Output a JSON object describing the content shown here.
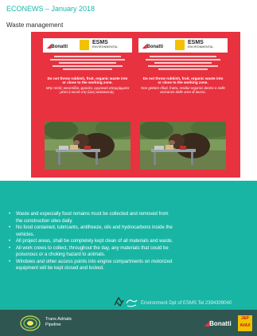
{
  "header": {
    "title": "ECONEWS – January 2018",
    "subtitle": "Waste management"
  },
  "poster": {
    "panels": [
      {
        "brand_left": "Bonatti",
        "brand_mid": "J&P AVAX",
        "brand_right": "ESMS",
        "brand_right_sub": "ENVIRONMENTAL",
        "warning_en": "Do not throw rubbish, fruit, organic waste into or close to the working zone.",
        "warning_local": "Μην πετάς σκουπίδια, φρούτα, οργανικά απορρίμματα μέσα ή κοντά στη ζώνη κατασκευής."
      },
      {
        "brand_left": "Bonatti",
        "brand_mid": "J&P AVAX",
        "brand_right": "ESMS",
        "brand_right_sub": "ENVIRONMENTAL",
        "warning_en": "Do not throw rubbish, fruit, organic waste into or close to the working zone.",
        "warning_local": "Non gettare rifiuti, frutta, residui organici dentro o nelle vicinanze delle aree di lavoro."
      }
    ]
  },
  "bullets": [
    "Waste and especially food remains must be collected and removed from",
    "the construction sites daily.",
    "No food contained, lubricants, antifreeze, oils and hydrocarbons inside the",
    "vehicles.",
    "All project areas, shall be completely kept clean of all materials and waste.",
    "All work crews to collect, throughout the day, any materials that could be",
    "poisonous or a choking hazard to animals.",
    "Windows and other access points into engine compartments on motorized",
    "equipment will be kept closed and locked."
  ],
  "bullet_markers": [
    true,
    false,
    true,
    false,
    true,
    true,
    false,
    true,
    false
  ],
  "env_note": "Environment Dpt of ESMS Tel 2394309040",
  "footer": {
    "tap_line1": "Trans Adriatic",
    "tap_line2": "Pipeline",
    "bonatti": "Bonatti",
    "jp_line1": "J&P",
    "jp_line2": "AVAX"
  },
  "colors": {
    "accent_teal": "#19b5a4",
    "poster_red": "#e8323f",
    "footer_bg": "#2f5650"
  }
}
